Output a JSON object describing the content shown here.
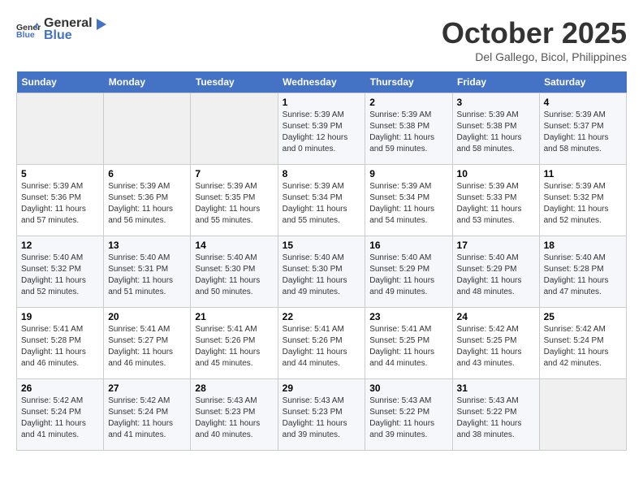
{
  "header": {
    "logo_general": "General",
    "logo_blue": "Blue",
    "title": "October 2025",
    "location": "Del Gallego, Bicol, Philippines"
  },
  "days_of_week": [
    "Sunday",
    "Monday",
    "Tuesday",
    "Wednesday",
    "Thursday",
    "Friday",
    "Saturday"
  ],
  "weeks": [
    [
      {
        "day": "",
        "empty": true
      },
      {
        "day": "",
        "empty": true
      },
      {
        "day": "",
        "empty": true
      },
      {
        "day": "1",
        "sunrise": "5:39 AM",
        "sunset": "5:39 PM",
        "daylight": "12 hours and 0 minutes."
      },
      {
        "day": "2",
        "sunrise": "5:39 AM",
        "sunset": "5:38 PM",
        "daylight": "11 hours and 59 minutes."
      },
      {
        "day": "3",
        "sunrise": "5:39 AM",
        "sunset": "5:38 PM",
        "daylight": "11 hours and 58 minutes."
      },
      {
        "day": "4",
        "sunrise": "5:39 AM",
        "sunset": "5:37 PM",
        "daylight": "11 hours and 58 minutes."
      }
    ],
    [
      {
        "day": "5",
        "sunrise": "5:39 AM",
        "sunset": "5:36 PM",
        "daylight": "11 hours and 57 minutes."
      },
      {
        "day": "6",
        "sunrise": "5:39 AM",
        "sunset": "5:36 PM",
        "daylight": "11 hours and 56 minutes."
      },
      {
        "day": "7",
        "sunrise": "5:39 AM",
        "sunset": "5:35 PM",
        "daylight": "11 hours and 55 minutes."
      },
      {
        "day": "8",
        "sunrise": "5:39 AM",
        "sunset": "5:34 PM",
        "daylight": "11 hours and 55 minutes."
      },
      {
        "day": "9",
        "sunrise": "5:39 AM",
        "sunset": "5:34 PM",
        "daylight": "11 hours and 54 minutes."
      },
      {
        "day": "10",
        "sunrise": "5:39 AM",
        "sunset": "5:33 PM",
        "daylight": "11 hours and 53 minutes."
      },
      {
        "day": "11",
        "sunrise": "5:39 AM",
        "sunset": "5:32 PM",
        "daylight": "11 hours and 52 minutes."
      }
    ],
    [
      {
        "day": "12",
        "sunrise": "5:40 AM",
        "sunset": "5:32 PM",
        "daylight": "11 hours and 52 minutes."
      },
      {
        "day": "13",
        "sunrise": "5:40 AM",
        "sunset": "5:31 PM",
        "daylight": "11 hours and 51 minutes."
      },
      {
        "day": "14",
        "sunrise": "5:40 AM",
        "sunset": "5:30 PM",
        "daylight": "11 hours and 50 minutes."
      },
      {
        "day": "15",
        "sunrise": "5:40 AM",
        "sunset": "5:30 PM",
        "daylight": "11 hours and 49 minutes."
      },
      {
        "day": "16",
        "sunrise": "5:40 AM",
        "sunset": "5:29 PM",
        "daylight": "11 hours and 49 minutes."
      },
      {
        "day": "17",
        "sunrise": "5:40 AM",
        "sunset": "5:29 PM",
        "daylight": "11 hours and 48 minutes."
      },
      {
        "day": "18",
        "sunrise": "5:40 AM",
        "sunset": "5:28 PM",
        "daylight": "11 hours and 47 minutes."
      }
    ],
    [
      {
        "day": "19",
        "sunrise": "5:41 AM",
        "sunset": "5:28 PM",
        "daylight": "11 hours and 46 minutes."
      },
      {
        "day": "20",
        "sunrise": "5:41 AM",
        "sunset": "5:27 PM",
        "daylight": "11 hours and 46 minutes."
      },
      {
        "day": "21",
        "sunrise": "5:41 AM",
        "sunset": "5:26 PM",
        "daylight": "11 hours and 45 minutes."
      },
      {
        "day": "22",
        "sunrise": "5:41 AM",
        "sunset": "5:26 PM",
        "daylight": "11 hours and 44 minutes."
      },
      {
        "day": "23",
        "sunrise": "5:41 AM",
        "sunset": "5:25 PM",
        "daylight": "11 hours and 44 minutes."
      },
      {
        "day": "24",
        "sunrise": "5:42 AM",
        "sunset": "5:25 PM",
        "daylight": "11 hours and 43 minutes."
      },
      {
        "day": "25",
        "sunrise": "5:42 AM",
        "sunset": "5:24 PM",
        "daylight": "11 hours and 42 minutes."
      }
    ],
    [
      {
        "day": "26",
        "sunrise": "5:42 AM",
        "sunset": "5:24 PM",
        "daylight": "11 hours and 41 minutes."
      },
      {
        "day": "27",
        "sunrise": "5:42 AM",
        "sunset": "5:24 PM",
        "daylight": "11 hours and 41 minutes."
      },
      {
        "day": "28",
        "sunrise": "5:43 AM",
        "sunset": "5:23 PM",
        "daylight": "11 hours and 40 minutes."
      },
      {
        "day": "29",
        "sunrise": "5:43 AM",
        "sunset": "5:23 PM",
        "daylight": "11 hours and 39 minutes."
      },
      {
        "day": "30",
        "sunrise": "5:43 AM",
        "sunset": "5:22 PM",
        "daylight": "11 hours and 39 minutes."
      },
      {
        "day": "31",
        "sunrise": "5:43 AM",
        "sunset": "5:22 PM",
        "daylight": "11 hours and 38 minutes."
      },
      {
        "day": "",
        "empty": true
      }
    ]
  ]
}
